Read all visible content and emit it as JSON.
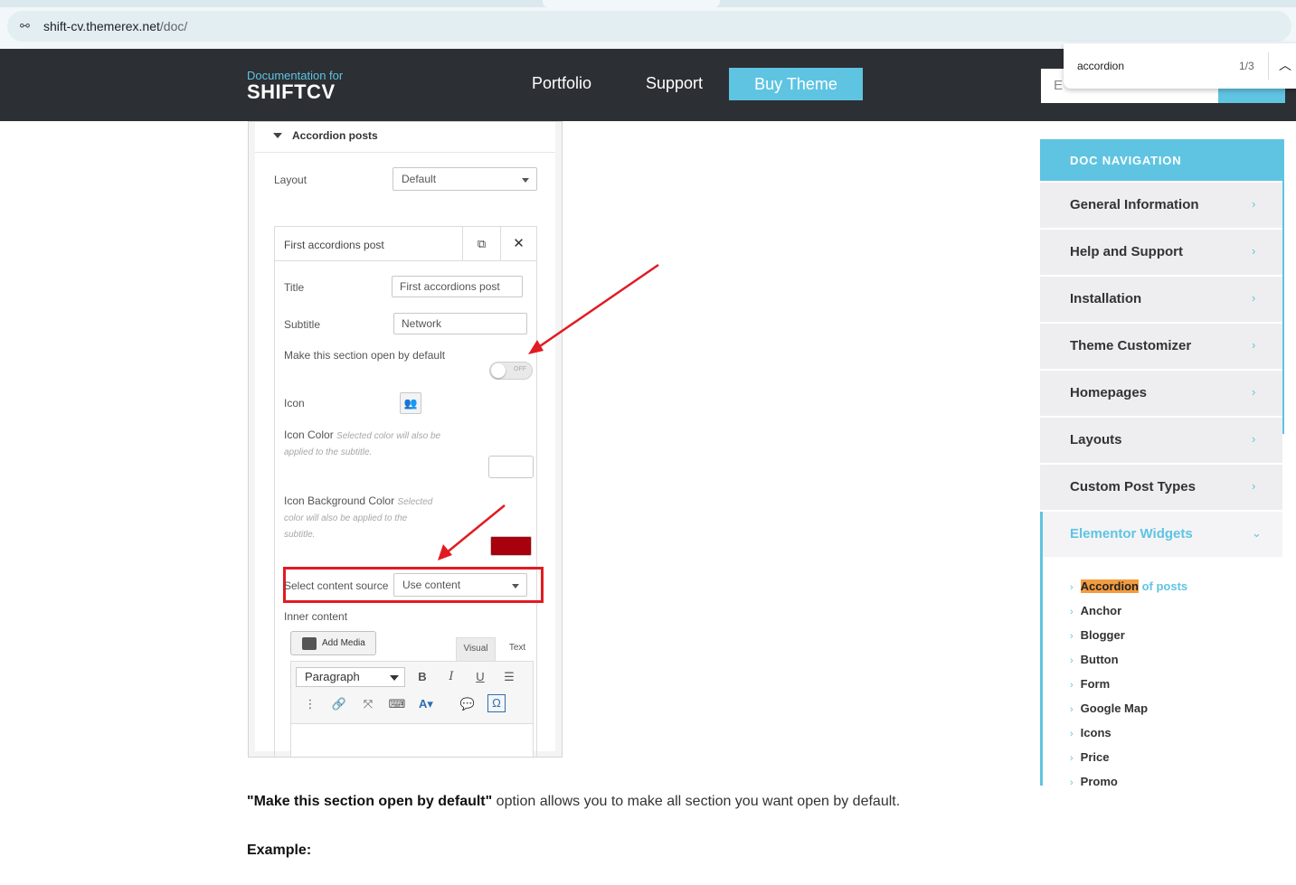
{
  "browser": {
    "url_host": "shift-cv.themerex.net",
    "url_path": "/doc/"
  },
  "header": {
    "brand_sub": "Documentation for",
    "brand_main": "SHIFTCV",
    "nav": [
      "Portfolio",
      "Support"
    ],
    "buy_label": "Buy Theme",
    "search_placeholder": "E"
  },
  "findbar": {
    "query": "accordion",
    "count": "1/3"
  },
  "panel": {
    "section_title": "Accordion posts",
    "layout_label": "Layout",
    "layout_value": "Default",
    "item_title": "First accordions post",
    "title_label": "Title",
    "title_value": "First accordions post",
    "subtitle_label": "Subtitle",
    "subtitle_value": "Network",
    "open_label": "Make this section open by default",
    "toggle_text": "OFF",
    "icon_label": "Icon",
    "icon_color_label": "Icon Color",
    "icon_color_hint_1": "Selected color will also be",
    "icon_color_hint_2": "applied to the subtitle.",
    "icon_bg_label": "Icon Background Color",
    "icon_bg_hint_1": "Selected",
    "icon_bg_hint_2": "color will also be applied to the",
    "icon_bg_hint_3": "subtitle.",
    "icon_bg_color": "#a8000c",
    "source_label": "Select content source",
    "source_value": "Use content",
    "inner_label": "Inner content",
    "add_media": "Add Media",
    "tab_visual": "Visual",
    "tab_text": "Text",
    "paragraph": "Paragraph"
  },
  "content": {
    "option_name": "\"Make this section open by default\"",
    "option_desc": " option allows you to make all section you want open by default.",
    "example": "Example:"
  },
  "docnav": {
    "title": "DOC NAVIGATION",
    "items": [
      "General Information",
      "Help and Support",
      "Installation",
      "Theme Customizer",
      "Homepages",
      "Layouts",
      "Custom Post Types",
      "Elementor Widgets"
    ],
    "sub_current_hl": "Accordion",
    "sub_current_rest": " of posts",
    "sub_items": [
      "Anchor",
      "Blogger",
      "Button",
      "Form",
      "Google Map",
      "Icons",
      "Price",
      "Promo"
    ]
  },
  "colors": {
    "accent": "#5fc4e2",
    "header_bg": "#2c2f33",
    "highlight": "#f39c40",
    "annotation_red": "#e11b22"
  }
}
